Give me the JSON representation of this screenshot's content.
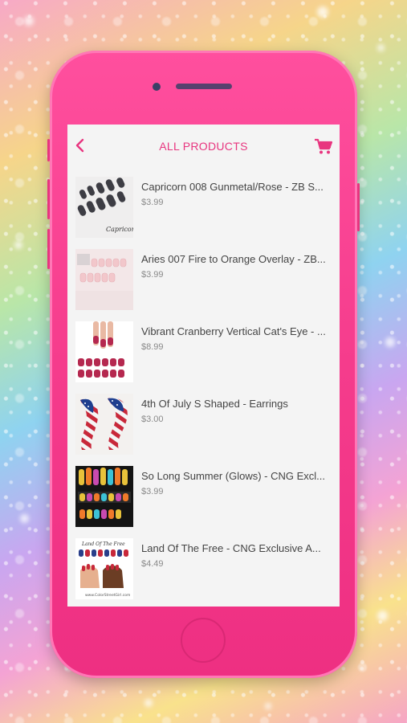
{
  "header": {
    "title": "ALL PRODUCTS",
    "back_icon": "chevron-left-icon",
    "cart_icon": "cart-icon",
    "accent": "#e8357f"
  },
  "products": [
    {
      "name": "Capricorn 008 Gunmetal/Rose - ZB S...",
      "price": "$3.99",
      "thumb_label": "Capricorn"
    },
    {
      "name": "Aries 007 Fire to Orange Overlay - ZB...",
      "price": "$3.99"
    },
    {
      "name": "Vibrant Cranberry Vertical Cat's Eye - ...",
      "price": "$8.99"
    },
    {
      "name": "4th Of July S Shaped - Earrings",
      "price": "$3.00"
    },
    {
      "name": "So Long Summer (Glows) - CNG Excl...",
      "price": "$3.99"
    },
    {
      "name": "Land Of The Free - CNG Exclusive A...",
      "price": "$4.49",
      "thumb_label": "Land Of The Free"
    }
  ],
  "colors": {
    "phone": "#f53c8c",
    "screen": "#f4f4f4"
  }
}
